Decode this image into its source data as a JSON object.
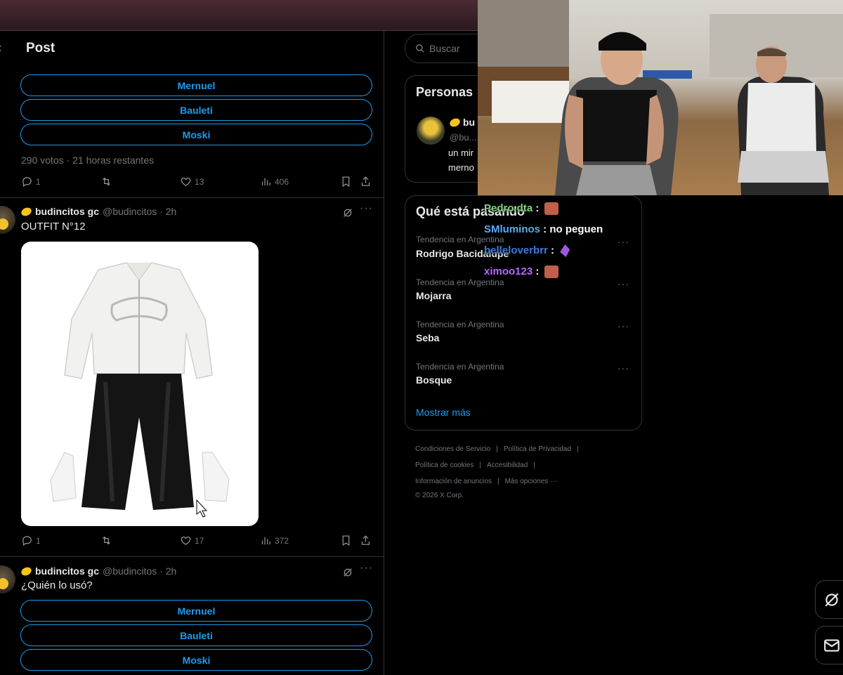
{
  "post_header": {
    "title": "Post"
  },
  "poll_top": {
    "options": [
      "Mernuel",
      "Bauleti",
      "Moski"
    ],
    "meta": "290 votos · 21 horas restantes",
    "stats": {
      "replies": "1",
      "likes": "13",
      "views": "406"
    }
  },
  "tweet_outfit": {
    "name": "budincitos gc",
    "handle": "@budincitos · 2h",
    "text": "OUTFIT N°12",
    "stats": {
      "replies": "1",
      "likes": "17",
      "views": "372"
    }
  },
  "tweet_quien": {
    "name": "budincitos gc",
    "handle": "@budincitos · 2h",
    "text": "¿Quién lo usó?",
    "options": [
      "Mernuel",
      "Bauleti",
      "Moski"
    ]
  },
  "search": {
    "placeholder": "Buscar"
  },
  "people_card": {
    "title": "Personas",
    "name": "bu",
    "handle": "@bu...",
    "bio_lines": [
      "un mir",
      "merno"
    ]
  },
  "trends_card": {
    "title": "Qué está pasando",
    "trends": [
      {
        "context": "Tendencia en Argentina",
        "name": "Rodrigo Bacidalupe"
      },
      {
        "context": "Tendencia en Argentina",
        "name": "Mojarra"
      },
      {
        "context": "Tendencia en Argentina",
        "name": "Seba"
      },
      {
        "context": "Tendencia en Argentina",
        "name": "Bosque"
      }
    ],
    "show_more": "Mostrar más"
  },
  "footer": {
    "line1": [
      "Condiciones de Servicio",
      "Política de Privacidad"
    ],
    "line2": [
      "Política de cookies",
      "Accesibilidad"
    ],
    "line3": [
      "Información de anuncios",
      "Más opciones ···"
    ],
    "copyright": "© 2026 X Corp."
  },
  "chat": [
    {
      "user": "Pedro.dta",
      "message": "",
      "color": "#7ed67a"
    },
    {
      "user": "SMluminos",
      "message": "no peguen",
      "color": "#5aa9ff"
    },
    {
      "user": "belleloverbrr",
      "message": "",
      "color": "#3d7be0"
    },
    {
      "user": "ximoo123",
      "message": "",
      "color": "#b36bff"
    }
  ],
  "colors": {
    "accent": "#1d9bf0",
    "muted": "#71767b",
    "background": "#000000"
  },
  "icons": [
    "back-arrow-icon",
    "reply-icon",
    "retweet-icon",
    "like-icon",
    "views-icon",
    "bookmark-icon",
    "share-icon",
    "grok-icon",
    "search-icon",
    "mail-icon"
  ]
}
